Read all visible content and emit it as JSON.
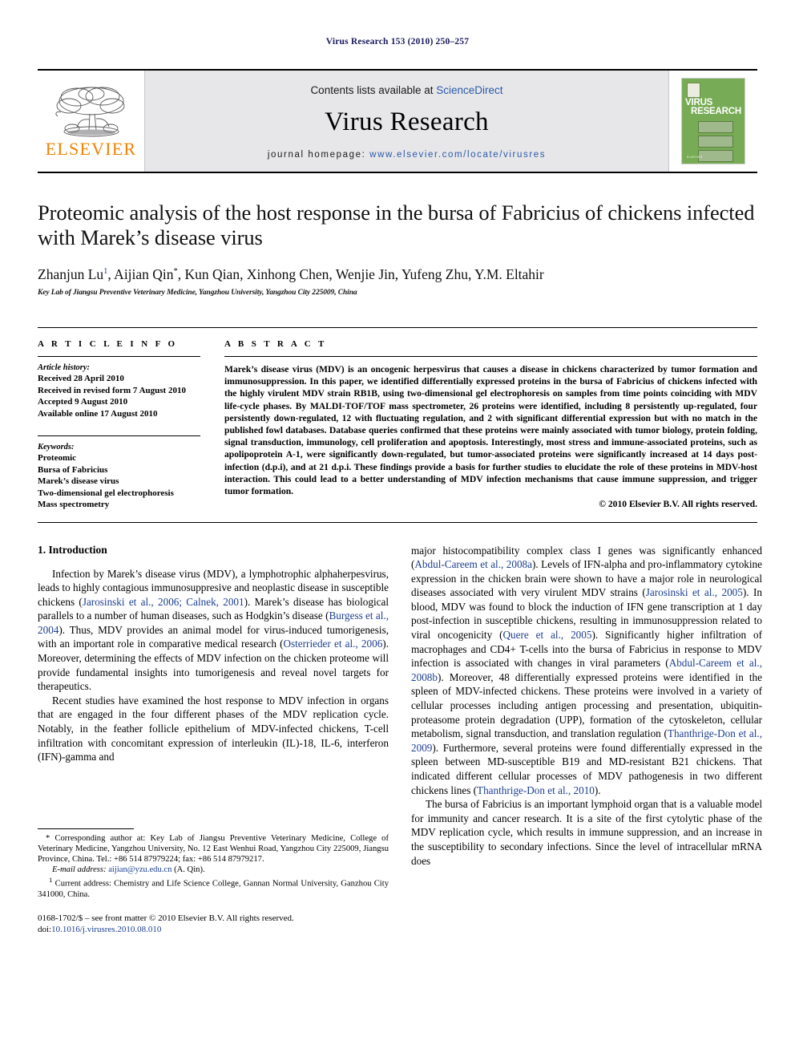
{
  "running_head": "Virus Research 153 (2010) 250–257",
  "masthead": {
    "publisher_name": "ELSEVIER",
    "contents_prefix": "Contents lists available at ",
    "contents_link": "ScienceDirect",
    "journal_name": "Virus Research",
    "homepage_prefix": "journal homepage: ",
    "homepage_url": "www.elsevier.com/locate/virusres",
    "cover_title_line1": "VIRUS",
    "cover_title_line2": "RESEARCH",
    "cover_footer": "ELSEVIER"
  },
  "article": {
    "title": "Proteomic analysis of the host response in the bursa of Fabricius of chickens infected with Marek’s disease virus",
    "authors_plain": "Zhanjun Lu",
    "authors_rest": ", Aijian Qin",
    "authors_tail": ", Kun Qian, Xinhong Chen, Wenjie Jin, Yufeng Zhu, Y.M. Eltahir",
    "author_sup_1": "1",
    "author_sup_star": "*",
    "affiliation": "Key Lab of Jiangsu Preventive Veterinary Medicine, Yangzhou University, Yangzhou City 225009, China"
  },
  "info": {
    "label": "A R T I C L E    I N F O",
    "history_label": "Article history:",
    "history": [
      "Received 28 April 2010",
      "Received in revised form 7 August 2010",
      "Accepted 9 August 2010",
      "Available online 17 August 2010"
    ],
    "keywords_label": "Keywords:",
    "keywords": [
      "Proteomic",
      "Bursa of Fabricius",
      "Marek’s disease virus",
      "Two-dimensional gel electrophoresis",
      "Mass spectrometry"
    ]
  },
  "abstract": {
    "label": "A B S T R A C T",
    "text": "Marek’s disease virus (MDV) is an oncogenic herpesvirus that causes a disease in chickens characterized by tumor formation and immunosuppression. In this paper, we identified differentially expressed proteins in the bursa of Fabricius of chickens infected with the highly virulent MDV strain RB1B, using two-dimensional gel electrophoresis on samples from time points coinciding with MDV life-cycle phases. By MALDI-TOF/TOF mass spectrometer, 26 proteins were identified, including 8 persistently up-regulated, four persistently down-regulated, 12 with fluctuating regulation, and 2 with significant differential expression but with no match in the published fowl databases. Database queries confirmed that these proteins were mainly associated with tumor biology, protein folding, signal transduction, immunology, cell proliferation and apoptosis. Interestingly, most stress and immune-associated proteins, such as apolipoprotein A-1, were significantly down-regulated, but tumor-associated proteins were significantly increased at 14 days post-infection (d.p.i), and at 21 d.p.i. These findings provide a basis for further studies to elucidate the role of these proteins in MDV-host interaction. This could lead to a better understanding of MDV infection mechanisms that cause immune suppression, and trigger tumor formation.",
    "copyright": "© 2010 Elsevier B.V. All rights reserved."
  },
  "body": {
    "section_number_title": "1. Introduction",
    "left_para_1_a": "Infection by Marek’s disease virus (MDV), a lymphotrophic alphaherpesvirus, leads to highly contagious immunosuppresive and neoplastic disease in susceptible chickens (",
    "left_para_1_cite1": "Jarosinski et al., 2006; Calnek, 2001",
    "left_para_1_b": "). Marek’s disease has biological parallels to a number of human diseases, such as Hodgkin’s disease (",
    "left_para_1_cite2": "Burgess et al., 2004",
    "left_para_1_c": "). Thus, MDV provides an animal model for virus-induced tumorigenesis, with an important role in comparative medical research (",
    "left_para_1_cite3": "Osterrieder et al., 2006",
    "left_para_1_d": "). Moreover, determining the effects of MDV infection on the chicken proteome will provide fundamental insights into tumorigenesis and reveal novel targets for therapeutics.",
    "left_para_2": "Recent studies have examined the host response to MDV infection in organs that are engaged in the four different phases of the MDV replication cycle. Notably, in the feather follicle epithelium of MDV-infected chickens, T-cell infiltration with concomitant expression of interleukin (IL)-18, IL-6, interferon (IFN)-gamma and",
    "right_para_1_a": "major histocompatibility complex class I genes was significantly enhanced (",
    "right_para_1_cite1": "Abdul-Careem et al., 2008a",
    "right_para_1_b": "). Levels of IFN-alpha and pro-inflammatory cytokine expression in the chicken brain were shown to have a major role in neurological diseases associated with very virulent MDV strains (",
    "right_para_1_cite2": "Jarosinski et al., 2005",
    "right_para_1_c": "). In blood, MDV was found to block the induction of IFN gene transcription at 1 day post-infection in susceptible chickens, resulting in immunosuppression related to viral oncogenicity (",
    "right_para_1_cite3": "Quere et al., 2005",
    "right_para_1_d": "). Significantly higher infiltration of macrophages and CD4+ T-cells into the bursa of Fabricius in response to MDV infection is associated with changes in viral parameters (",
    "right_para_1_cite4": "Abdul-Careem et al., 2008b",
    "right_para_1_e": "). Moreover, 48 differentially expressed proteins were identified in the spleen of MDV-infected chickens. These proteins were involved in a variety of cellular processes including antigen processing and presentation, ubiquitin-proteasome protein degradation (UPP), formation of the cytoskeleton, cellular metabolism, signal transduction, and translation regulation (",
    "right_para_1_cite5": "Thanthrige-Don et al., 2009",
    "right_para_1_f": "). Furthermore, several proteins were found differentially expressed in the spleen between MD-susceptible B19 and MD-resistant B21 chickens. That indicated different cellular processes of MDV pathogenesis in two different chickens lines (",
    "right_para_1_cite6": "Thanthrige-Don et al., 2010",
    "right_para_1_g": ").",
    "right_para_2": "The bursa of Fabricius is an important lymphoid organ that is a valuable model for immunity and cancer research. It is a site of the first cytolytic phase of the MDV replication cycle, which results in immune suppression, and an increase in the susceptibility to secondary infections. Since the level of intracellular mRNA does"
  },
  "footnotes": {
    "corresponding": "* Corresponding author at: Key Lab of Jiangsu Preventive Veterinary Medicine, College of Veterinary Medicine, Yangzhou University, No. 12 East Wenhui Road, Yangzhou City 225009, Jiangsu Province, China. Tel.: +86 514 87979224; fax: +86 514 87979217.",
    "email_label": "E-mail address:",
    "email_link": "aijian@yzu.edu.cn",
    "email_suffix": "(A. Qin).",
    "current_address_marker": "1",
    "current_address": "Current address: Chemistry and Life Science College, Gannan Normal University, Ganzhou City 341000, China.",
    "issn_line": "0168-1702/$ – see front matter © 2010 Elsevier B.V. All rights reserved.",
    "doi_label": "doi:",
    "doi_value": "10.1016/j.virusres.2010.08.010"
  },
  "colors": {
    "link_blue": "#2b59a8",
    "cite_blue": "#1d3f8f",
    "elsevier_orange": "#ef8200",
    "cover_green": "#78ab55",
    "masthead_gray": "#e7e7e9",
    "running_head_navy": "#1a1a5e"
  }
}
